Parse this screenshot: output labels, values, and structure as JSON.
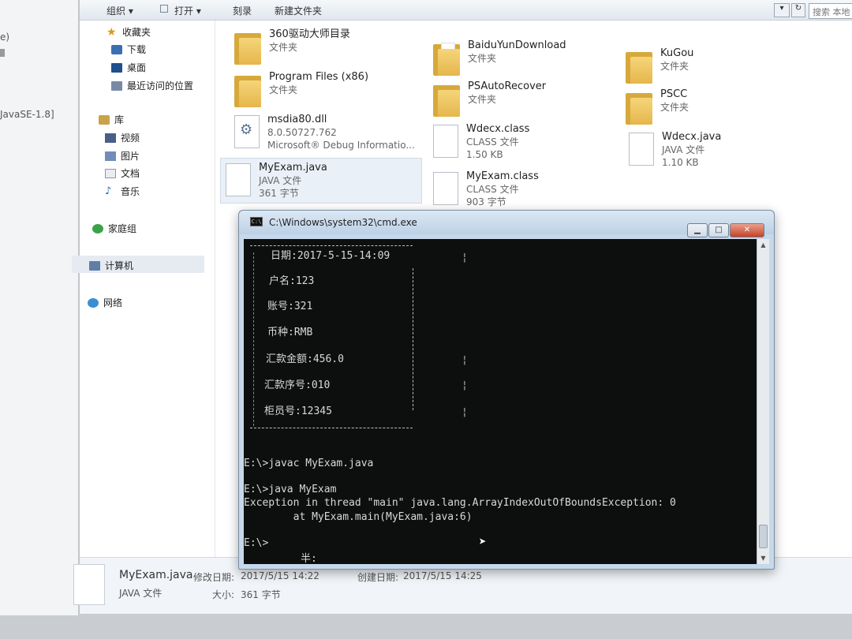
{
  "left_window": {
    "fragments": [
      "e)",
      "JavaSE-1.8]"
    ]
  },
  "toolbar": {
    "organize": "组织 ▾",
    "open": "打开 ▾",
    "burn": "刻录",
    "new_folder": "新建文件夹",
    "search_placeholder": "搜索 本地"
  },
  "nav": {
    "favorites": "收藏夹",
    "downloads": "下载",
    "desktop": "桌面",
    "recent": "最近访问的位置",
    "libraries": "库",
    "videos": "视频",
    "pictures": "图片",
    "documents": "文档",
    "music": "音乐",
    "homegroup": "家庭组",
    "computer": "计算机",
    "network": "网络"
  },
  "files": [
    {
      "name": "360驱动大师目录",
      "line2": "文件夹",
      "line3": ""
    },
    {
      "name": "BaiduYunDownload",
      "line2": "文件夹",
      "line3": ""
    },
    {
      "name": "KuGou",
      "line2": "文件夹",
      "line3": ""
    },
    {
      "name": "Program Files (x86)",
      "line2": "文件夹",
      "line3": ""
    },
    {
      "name": "PSAutoRecover",
      "line2": "文件夹",
      "line3": ""
    },
    {
      "name": "PSCC",
      "line2": "文件夹",
      "line3": ""
    },
    {
      "name": "msdia80.dll",
      "line2": "8.0.50727.762",
      "line3": "Microsoft® Debug Informatio..."
    },
    {
      "name": "Wdecx.class",
      "line2": "CLASS 文件",
      "line3": "1.50 KB"
    },
    {
      "name": "Wdecx.java",
      "line2": "JAVA 文件",
      "line3": "1.10 KB"
    },
    {
      "name": "MyExam.java",
      "line2": "JAVA 文件",
      "line3": "361 字节"
    },
    {
      "name": "MyExam.class",
      "line2": "CLASS 文件",
      "line3": "903 字节"
    }
  ],
  "details": {
    "name": "MyExam.java",
    "type": "JAVA 文件",
    "modified_label": "修改日期:",
    "modified_value": "2017/5/15 14:22",
    "size_label": "大小:",
    "size_value": "361 字节",
    "created_label": "创建日期:",
    "created_value": "2017/5/15 14:25"
  },
  "cmd": {
    "title": "C:\\Windows\\system32\\cmd.exe",
    "min_glyph": "▁",
    "max_glyph": "□",
    "close_glyph": "✕",
    "receipt": {
      "date": "日期:2017-5-15-14:09",
      "user": "户名:123",
      "account": "账号:321",
      "currency": "币种:RMB",
      "amount": "汇款金额:456.0",
      "serial": "汇款序号:010",
      "teller": "柜员号:12345"
    },
    "lines": {
      "javac": "E:\\>javac MyExam.java",
      "java": "E:\\>java MyExam",
      "exception": "Exception in thread \"main\" java.lang.ArrayIndexOutOfBoundsException: 0",
      "at": "        at MyExam.main(MyExam.java:6)",
      "prompt": "E:\\>",
      "ime": "半:"
    }
  },
  "colors": {
    "console_bg": "#0d0f0e",
    "console_text": "#d8d8d8",
    "folder": "#e6b64c",
    "close_button": "#c7412a"
  }
}
